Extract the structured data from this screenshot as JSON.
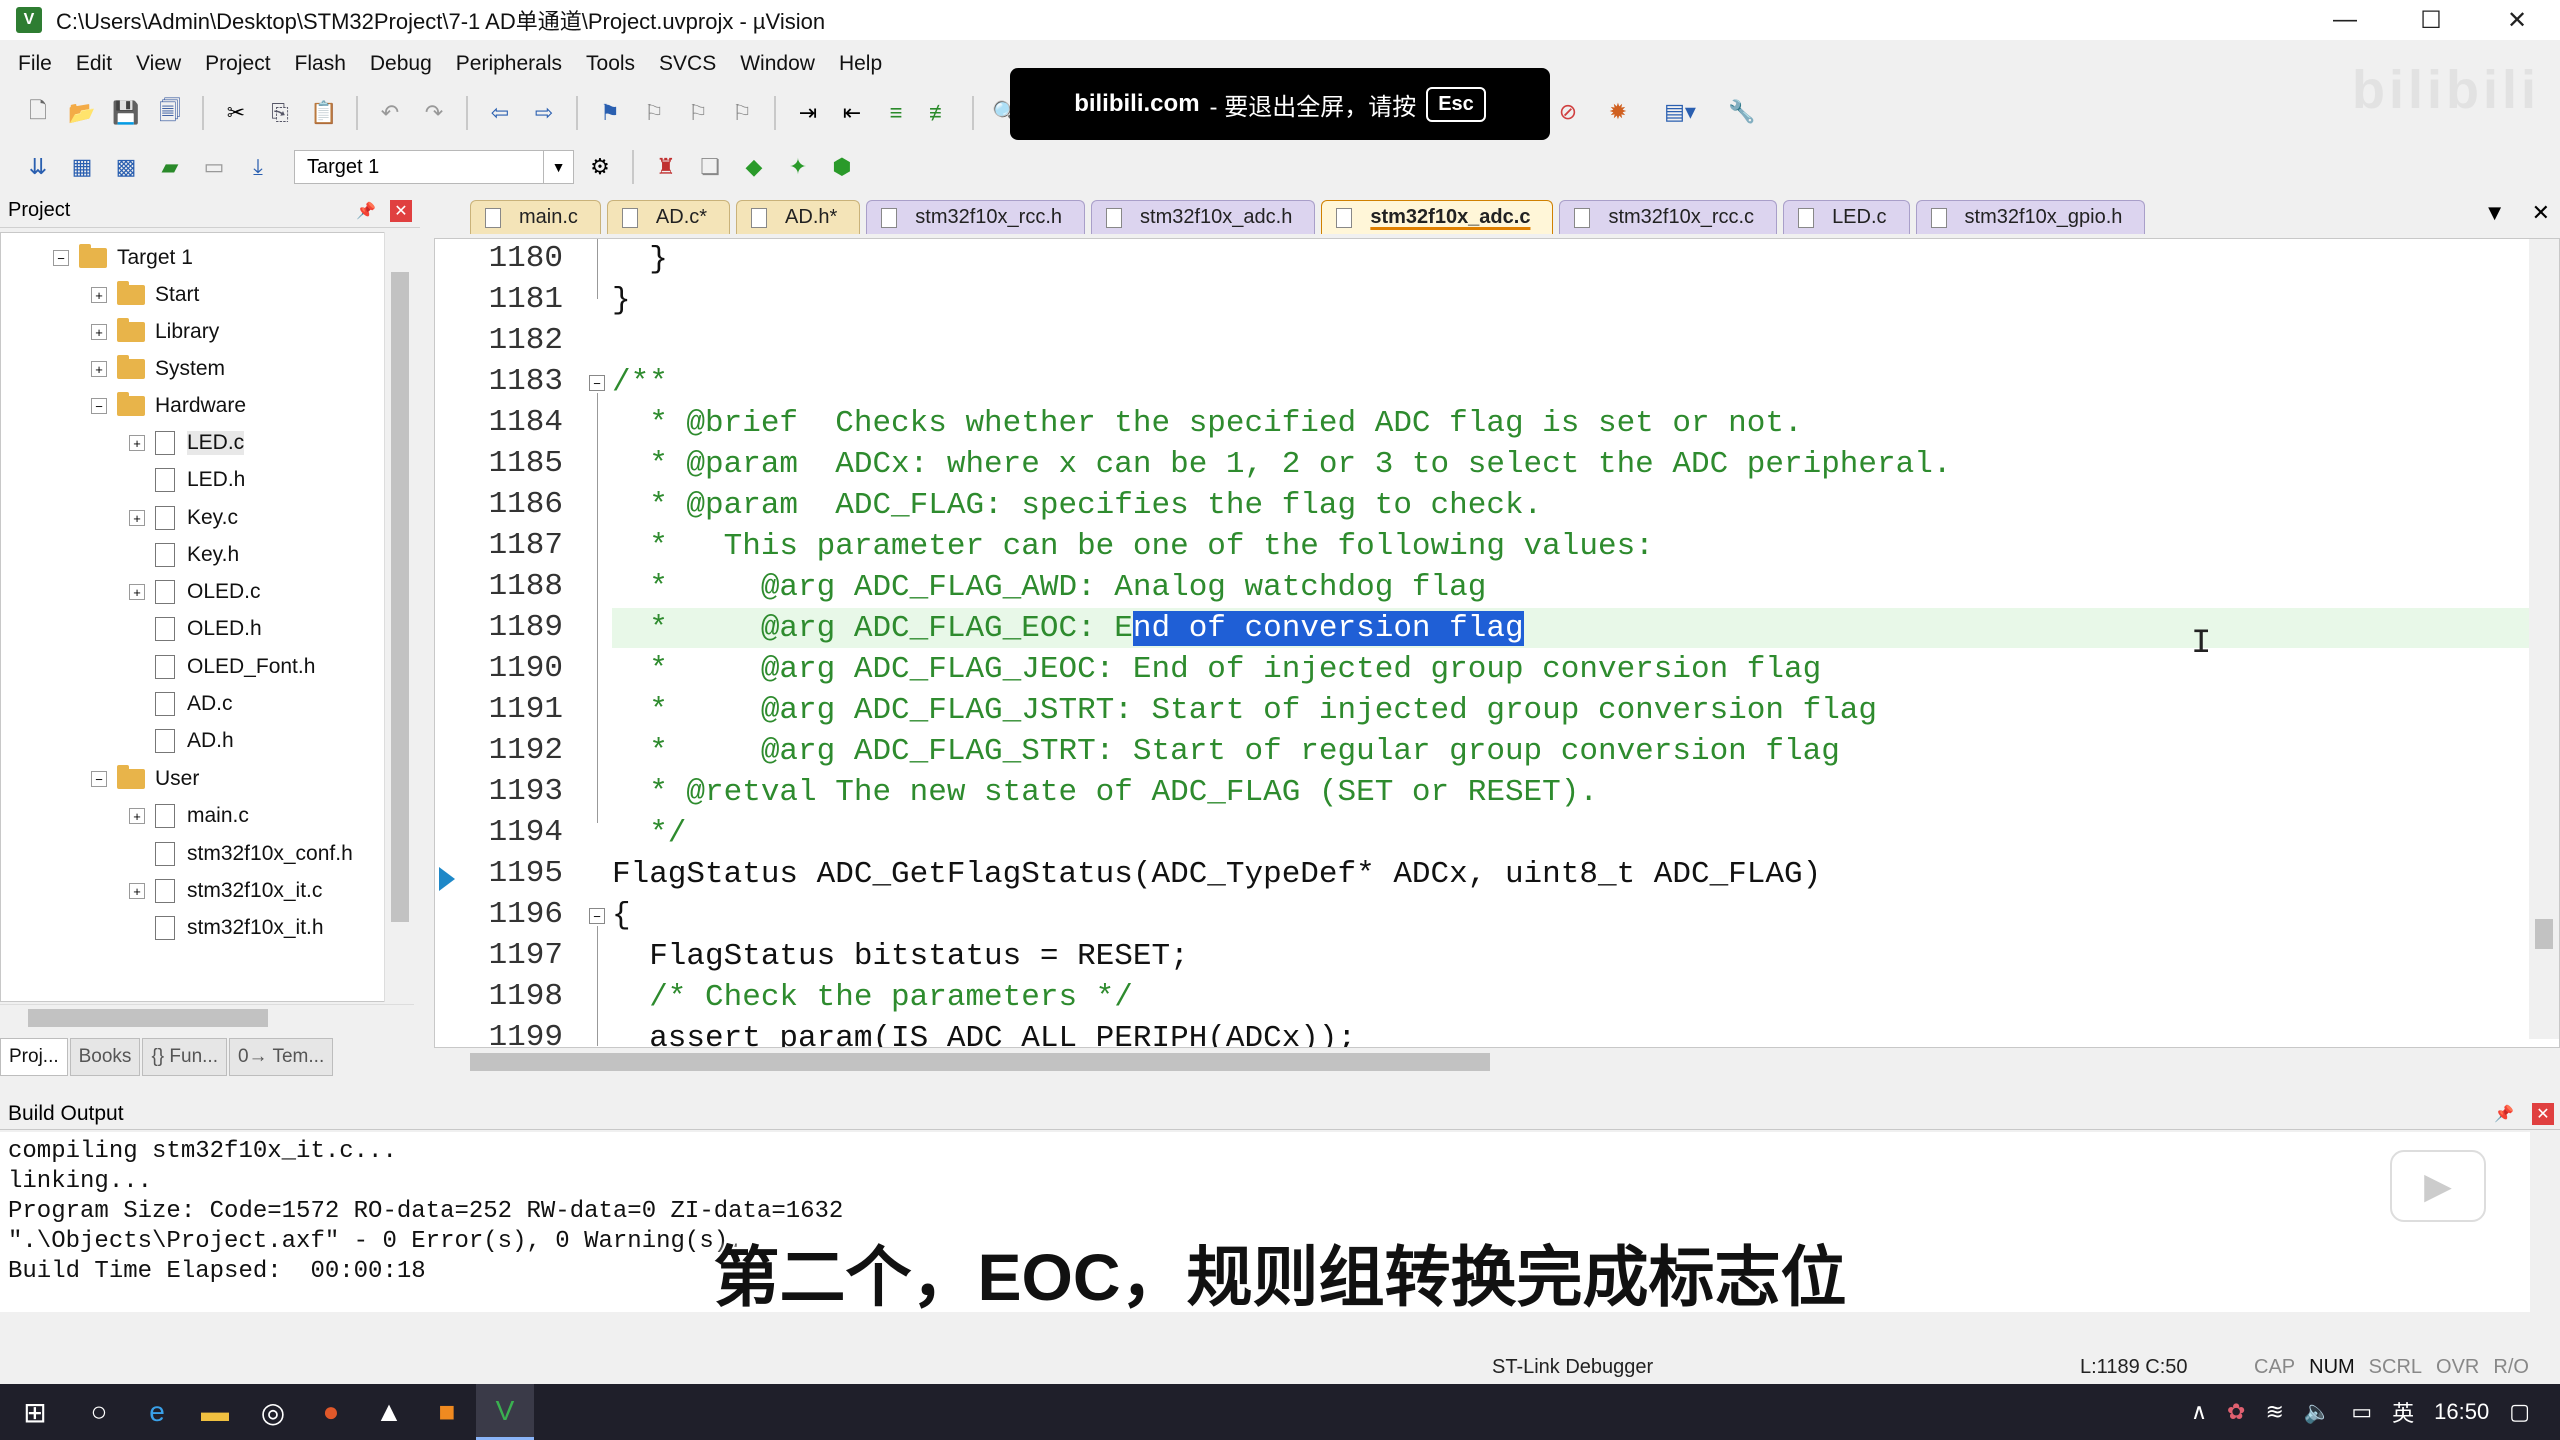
{
  "window": {
    "title": "C:\\Users\\Admin\\Desktop\\STM32Project\\7-1 AD单通道\\Project.uvprojx - µVision",
    "app_icon": "V",
    "buttons": [
      "—",
      "☐",
      "✕"
    ]
  },
  "menu": [
    "File",
    "Edit",
    "View",
    "Project",
    "Flash",
    "Debug",
    "Peripherals",
    "Tools",
    "SVCS",
    "Window",
    "Help"
  ],
  "toolbar": {
    "target": "Target 1"
  },
  "bilibili_banner": {
    "site": "bilibili.com",
    "text": "- 要退出全屏，请按",
    "key": "Esc"
  },
  "watermark": "bilibili",
  "project_panel": {
    "title": "Project",
    "tree": [
      {
        "label": "Target 1",
        "type": "root"
      },
      {
        "label": "Start",
        "type": "folder"
      },
      {
        "label": "Library",
        "type": "folder"
      },
      {
        "label": "System",
        "type": "folder"
      },
      {
        "label": "Hardware",
        "type": "folder"
      },
      {
        "label": "LED.c",
        "type": "file"
      },
      {
        "label": "LED.h",
        "type": "file"
      },
      {
        "label": "Key.c",
        "type": "file"
      },
      {
        "label": "Key.h",
        "type": "file"
      },
      {
        "label": "OLED.c",
        "type": "file"
      },
      {
        "label": "OLED.h",
        "type": "file"
      },
      {
        "label": "OLED_Font.h",
        "type": "file"
      },
      {
        "label": "AD.c",
        "type": "file"
      },
      {
        "label": "AD.h",
        "type": "file"
      },
      {
        "label": "User",
        "type": "folder"
      },
      {
        "label": "main.c",
        "type": "file"
      },
      {
        "label": "stm32f10x_conf.h",
        "type": "file"
      },
      {
        "label": "stm32f10x_it.c",
        "type": "file"
      },
      {
        "label": "stm32f10x_it.h",
        "type": "file"
      }
    ],
    "tabs": [
      "Proj...",
      "Books",
      "{} Fun...",
      "0→ Tem..."
    ]
  },
  "editor_tabs": [
    "main.c",
    "AD.c*",
    "AD.h*",
    "stm32f10x_rcc.h",
    "stm32f10x_adc.h",
    "stm32f10x_adc.c",
    "stm32f10x_rcc.c",
    "LED.c",
    "stm32f10x_gpio.h"
  ],
  "editor": {
    "lines": [
      {
        "num": "1180",
        "text": "  }"
      },
      {
        "num": "1181",
        "text": "}"
      },
      {
        "num": "1182",
        "text": ""
      },
      {
        "num": "1183",
        "text": "/**"
      },
      {
        "num": "1184",
        "text": "  * @brief  Checks whether the specified ADC flag is set or not."
      },
      {
        "num": "1185",
        "text": "  * @param  ADCx: where x can be 1, 2 or 3 to select the ADC peripheral."
      },
      {
        "num": "1186",
        "text": "  * @param  ADC_FLAG: specifies the flag to check."
      },
      {
        "num": "1187",
        "text": "  *   This parameter can be one of the following values:"
      },
      {
        "num": "1188",
        "text": "  *     @arg ADC_FLAG_AWD: Analog watchdog flag"
      },
      {
        "num": "1189",
        "text_before": "  *     @arg ADC_FLAG_EOC: E",
        "text_selected": "nd of conversion flag",
        "text_after": ""
      },
      {
        "num": "1190",
        "text": "  *     @arg ADC_FLAG_JEOC: End of injected group conversion flag"
      },
      {
        "num": "1191",
        "text": "  *     @arg ADC_FLAG_JSTRT: Start of injected group conversion flag"
      },
      {
        "num": "1192",
        "text": "  *     @arg ADC_FLAG_STRT: Start of regular group conversion flag"
      },
      {
        "num": "1193",
        "text": "  * @retval The new state of ADC_FLAG (SET or RESET)."
      },
      {
        "num": "1194",
        "text": "  */"
      },
      {
        "num": "1195",
        "text": "FlagStatus ADC_GetFlagStatus(ADC_TypeDef* ADCx, uint8_t ADC_FLAG)"
      },
      {
        "num": "1196",
        "text": "{"
      },
      {
        "num": "1197",
        "text": "  FlagStatus bitstatus = RESET;"
      },
      {
        "num": "1198",
        "text": "  /* Check the parameters */"
      },
      {
        "num": "1199",
        "text": "  assert_param(IS_ADC_ALL_PERIPH(ADCx));"
      }
    ]
  },
  "build_output": {
    "title": "Build Output",
    "lines": [
      "compiling stm32f10x_it.c...",
      "linking...",
      "Program Size: Code=1572 RO-data=252 RW-data=0 ZI-data=1632",
      "\".\\Objects\\Project.axf\" - 0 Error(s), 0 Warning(s).",
      "Build Time Elapsed:  00:00:18"
    ]
  },
  "subtitle": "第二个，EOC，规则组转换完成标志位",
  "status": {
    "debugger": "ST-Link Debugger",
    "position": "L:1189 C:50",
    "keys": [
      "CAP",
      "NUM",
      "SCRL",
      "OVR",
      "R/O"
    ]
  },
  "taskbar": {
    "ime": "英",
    "time": "16:50"
  },
  "colors": {
    "comment": "#2e8b2e",
    "selection": "#1f5fd6",
    "current_line": "#e8f8e8"
  }
}
